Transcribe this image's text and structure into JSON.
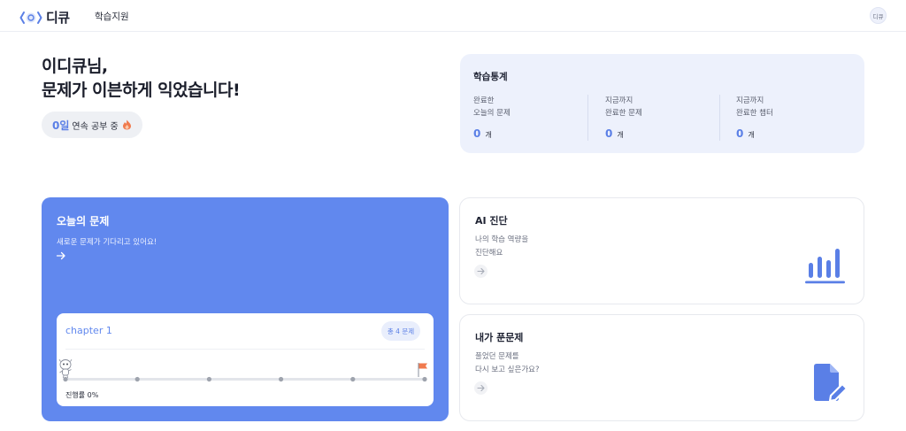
{
  "header": {
    "logo_text": "디큐",
    "nav": "학습지원",
    "avatar": "디큐"
  },
  "greeting": {
    "line1": "이디큐님,",
    "line2": "문제가 이븐하게 익었습니다!"
  },
  "streak": {
    "count": "0일",
    "label": "연속 공부 중"
  },
  "stats": {
    "title": "학습통계",
    "items": [
      {
        "line1": "완료한",
        "line2": "오늘의 문제",
        "value": "0",
        "unit": "개"
      },
      {
        "line1": "지금까지",
        "line2": "완료한 문제",
        "value": "0",
        "unit": "개"
      },
      {
        "line1": "지금까지",
        "line2": "완료한 챕터",
        "value": "0",
        "unit": "개"
      }
    ]
  },
  "today": {
    "title": "오늘의 문제",
    "subtitle": "새로운 문제가 기다리고 있어요!",
    "chapter": {
      "name": "chapter 1",
      "badge": "총 4 문제",
      "progress_text": "진행률 0%",
      "progress": 0,
      "steps": 6
    }
  },
  "ai_card": {
    "title": "AI 진단",
    "desc_line1": "나의 학습 역량을",
    "desc_line2": "진단해요"
  },
  "solved_card": {
    "title": "내가 푼문제",
    "desc_line1": "풀었던 문제를",
    "desc_line2": "다시 보고 싶은가요?"
  },
  "colors": {
    "accent": "#6188ee",
    "stats_bg": "#edf1fc",
    "flag": "#f07a4e"
  }
}
